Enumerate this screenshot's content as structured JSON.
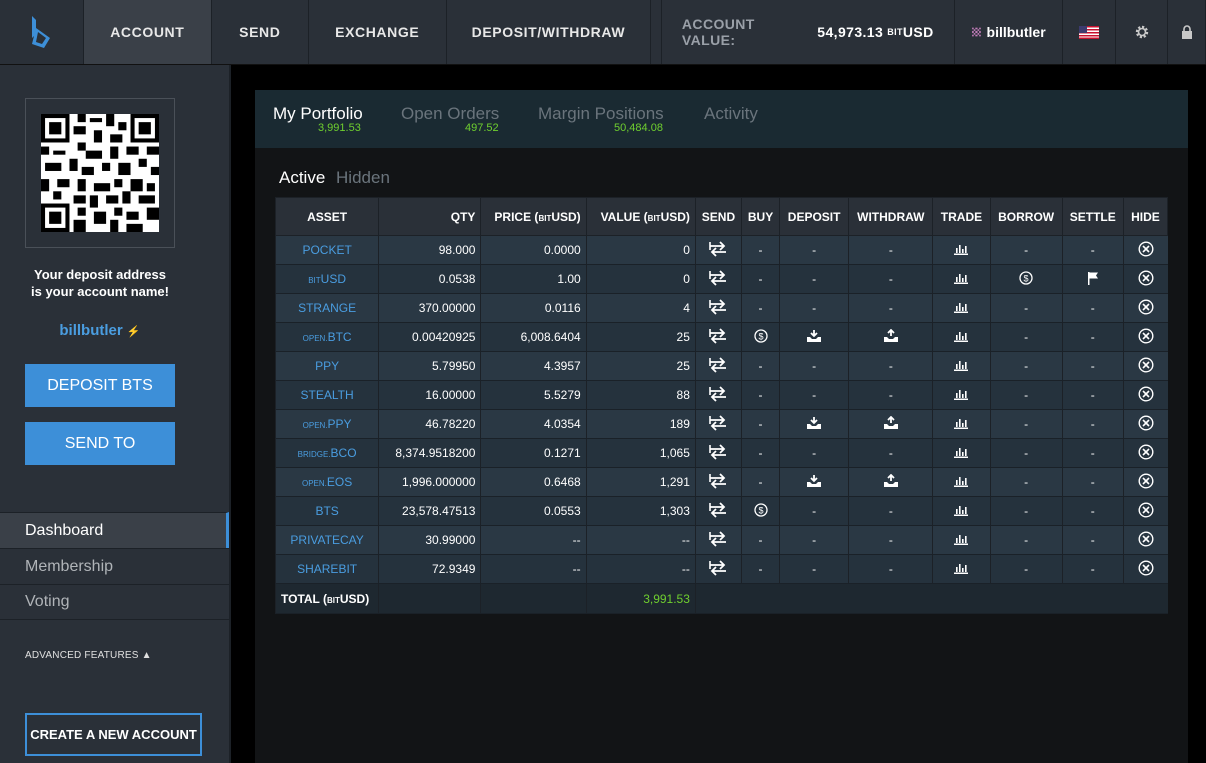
{
  "header": {
    "nav": [
      "ACCOUNT",
      "SEND",
      "EXCHANGE",
      "DEPOSIT/WITHDRAW"
    ],
    "account_value_label": "ACCOUNT VALUE:",
    "account_value": "54,973.13",
    "account_value_prefix": "BIT",
    "account_value_unit": "USD",
    "username": "billbutler"
  },
  "sidebar": {
    "deposit_note_line1": "Your deposit address",
    "deposit_note_line2": "is your account name!",
    "account_name": "billbutler",
    "account_name_suffix": "⚡",
    "deposit_button": "DEPOSIT BTS",
    "send_button": "SEND TO",
    "nav": [
      "Dashboard",
      "Membership",
      "Voting"
    ],
    "advanced": "ADVANCED FEATURES ▲",
    "create_button": "CREATE A NEW ACCOUNT"
  },
  "tabs": [
    {
      "label": "My Portfolio",
      "value": "3,991.53"
    },
    {
      "label": "Open Orders",
      "value": "497.52"
    },
    {
      "label": "Margin Positions",
      "value": "50,484.08"
    },
    {
      "label": "Activity",
      "value": ""
    }
  ],
  "subtabs": {
    "active": "Active",
    "hidden": "Hidden"
  },
  "table": {
    "headers": [
      "ASSET",
      "QTY",
      "PRICE (",
      "BIT",
      "USD)",
      "VALUE (",
      "BIT",
      "USD)",
      "SEND",
      "BUY",
      "DEPOSIT",
      "WITHDRAW",
      "TRADE",
      "BORROW",
      "SETTLE",
      "HIDE"
    ],
    "rows": [
      {
        "prefix": "",
        "asset": "POCKET",
        "qty": "98.000",
        "price": "0.0000",
        "value": "0",
        "buy": "-",
        "deposit": "-",
        "withdraw": "-",
        "borrow": "-",
        "settle": "-"
      },
      {
        "prefix": "BIT",
        "asset": "USD",
        "qty": "0.0538",
        "price": "1.00",
        "value": "0",
        "buy": "-",
        "deposit": "-",
        "withdraw": "-",
        "borrow": "$",
        "settle": "flag"
      },
      {
        "prefix": "",
        "asset": "STRANGE",
        "qty": "370.00000",
        "price": "0.0116",
        "value": "4",
        "buy": "-",
        "deposit": "-",
        "withdraw": "-",
        "borrow": "-",
        "settle": "-"
      },
      {
        "prefix": "OPEN.",
        "asset": "BTC",
        "qty": "0.00420925",
        "price": "6,008.6404",
        "value": "25",
        "buy": "$",
        "deposit": "dep",
        "withdraw": "wd",
        "borrow": "-",
        "settle": "-"
      },
      {
        "prefix": "",
        "asset": "PPY",
        "qty": "5.79950",
        "price": "4.3957",
        "value": "25",
        "buy": "-",
        "deposit": "-",
        "withdraw": "-",
        "borrow": "-",
        "settle": "-"
      },
      {
        "prefix": "",
        "asset": "STEALTH",
        "qty": "16.00000",
        "price": "5.5279",
        "value": "88",
        "buy": "-",
        "deposit": "-",
        "withdraw": "-",
        "borrow": "-",
        "settle": "-"
      },
      {
        "prefix": "OPEN.",
        "asset": "PPY",
        "qty": "46.78220",
        "price": "4.0354",
        "value": "189",
        "buy": "-",
        "deposit": "dep",
        "withdraw": "wd",
        "borrow": "-",
        "settle": "-"
      },
      {
        "prefix": "BRIDGE.",
        "asset": "BCO",
        "qty": "8,374.9518200",
        "price": "0.1271",
        "value": "1,065",
        "buy": "-",
        "deposit": "-",
        "withdraw": "-",
        "borrow": "-",
        "settle": "-"
      },
      {
        "prefix": "OPEN.",
        "asset": "EOS",
        "qty": "1,996.000000",
        "price": "0.6468",
        "value": "1,291",
        "buy": "-",
        "deposit": "dep",
        "withdraw": "wd",
        "borrow": "-",
        "settle": "-"
      },
      {
        "prefix": "",
        "asset": "BTS",
        "qty": "23,578.47513",
        "price": "0.0553",
        "value": "1,303",
        "buy": "$",
        "deposit": "-",
        "withdraw": "-",
        "borrow": "-",
        "settle": "-"
      },
      {
        "prefix": "",
        "asset": "PRIVATECAY",
        "qty": "30.99000",
        "price": "--",
        "value": "--",
        "buy": "-",
        "deposit": "-",
        "withdraw": "-",
        "borrow": "-",
        "settle": "-"
      },
      {
        "prefix": "",
        "asset": "SHAREBIT",
        "qty": "72.9349",
        "price": "--",
        "value": "--",
        "buy": "-",
        "deposit": "-",
        "withdraw": "-",
        "borrow": "-",
        "settle": "-"
      }
    ],
    "total_label": "TOTAL (",
    "total_prefix": "BIT",
    "total_unit": "USD)",
    "total_value": "3,991.53"
  }
}
